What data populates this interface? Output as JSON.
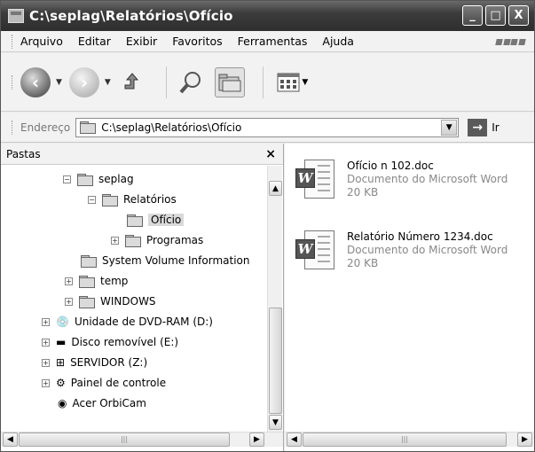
{
  "window": {
    "title": "C:\\seplag\\Relatórios\\Ofício",
    "minimize": "_",
    "maximize": "□",
    "close": "X"
  },
  "menu": [
    "Arquivo",
    "Editar",
    "Exibir",
    "Favoritos",
    "Ferramentas",
    "Ajuda"
  ],
  "toolbar": {
    "back_icon": "back-arrow-icon",
    "forward_icon": "forward-arrow-icon",
    "up_icon": "up-folder-icon",
    "search_icon": "search-icon",
    "folders_icon": "folders-icon",
    "views_icon": "views-icon"
  },
  "address": {
    "label": "Endereço",
    "value": "C:\\seplag\\Relatórios\\Ofício",
    "go_label": "Ir"
  },
  "pane": {
    "title": "Pastas",
    "close": "×"
  },
  "tree": [
    {
      "label": "seplag",
      "pm": "⊟"
    },
    {
      "label": "Relatórios",
      "pm": "⊟"
    },
    {
      "label": "Ofício",
      "pm": ""
    },
    {
      "label": "Programas",
      "pm": "⊞"
    },
    {
      "label": "System Volume Information",
      "pm": ""
    },
    {
      "label": "temp",
      "pm": "⊞"
    },
    {
      "label": "WINDOWS",
      "pm": "⊞"
    },
    {
      "label": "Unidade de DVD-RAM (D:)",
      "pm": "⊞"
    },
    {
      "label": "Disco removível (E:)",
      "pm": "⊞"
    },
    {
      "label": "SERVIDOR (Z:)",
      "pm": "⊞"
    },
    {
      "label": "Painel de controle",
      "pm": "⊞"
    },
    {
      "label": "Acer OrbiCam",
      "pm": ""
    }
  ],
  "files": [
    {
      "name": "Ofício n 102.doc",
      "type": "Documento do Microsoft Word",
      "size": "20 KB"
    },
    {
      "name": "Relatório Número 1234.doc",
      "type": "Documento do Microsoft Word",
      "size": "20 KB"
    }
  ],
  "scroll": {
    "up": "▲",
    "down": "▼",
    "left": "◀",
    "right": "▶",
    "grip": "|||"
  }
}
